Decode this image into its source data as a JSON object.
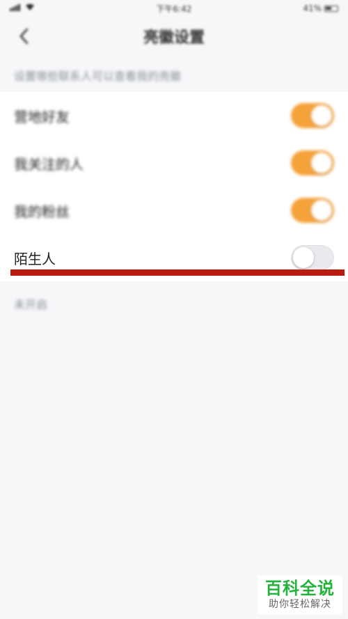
{
  "status_bar": {
    "time": "下午6:42",
    "battery": "41%"
  },
  "nav": {
    "title": "亮徽设置"
  },
  "section_hint": "设置哪些联系人可以查看我的亮徽",
  "rows": [
    {
      "label": "营地好友",
      "enabled": true
    },
    {
      "label": "我关注的人",
      "enabled": true
    },
    {
      "label": "我的粉丝",
      "enabled": true
    },
    {
      "label": "陌生人",
      "enabled": false
    }
  ],
  "footer_hint": "未开启",
  "watermark": {
    "title": "百科全说",
    "subtitle": "助你轻松解决"
  },
  "colors": {
    "toggle_on": "#f5a23a",
    "toggle_off": "#e9eaed",
    "highlight_underline": "#b81c0e",
    "watermark_green": "#22b33a"
  }
}
